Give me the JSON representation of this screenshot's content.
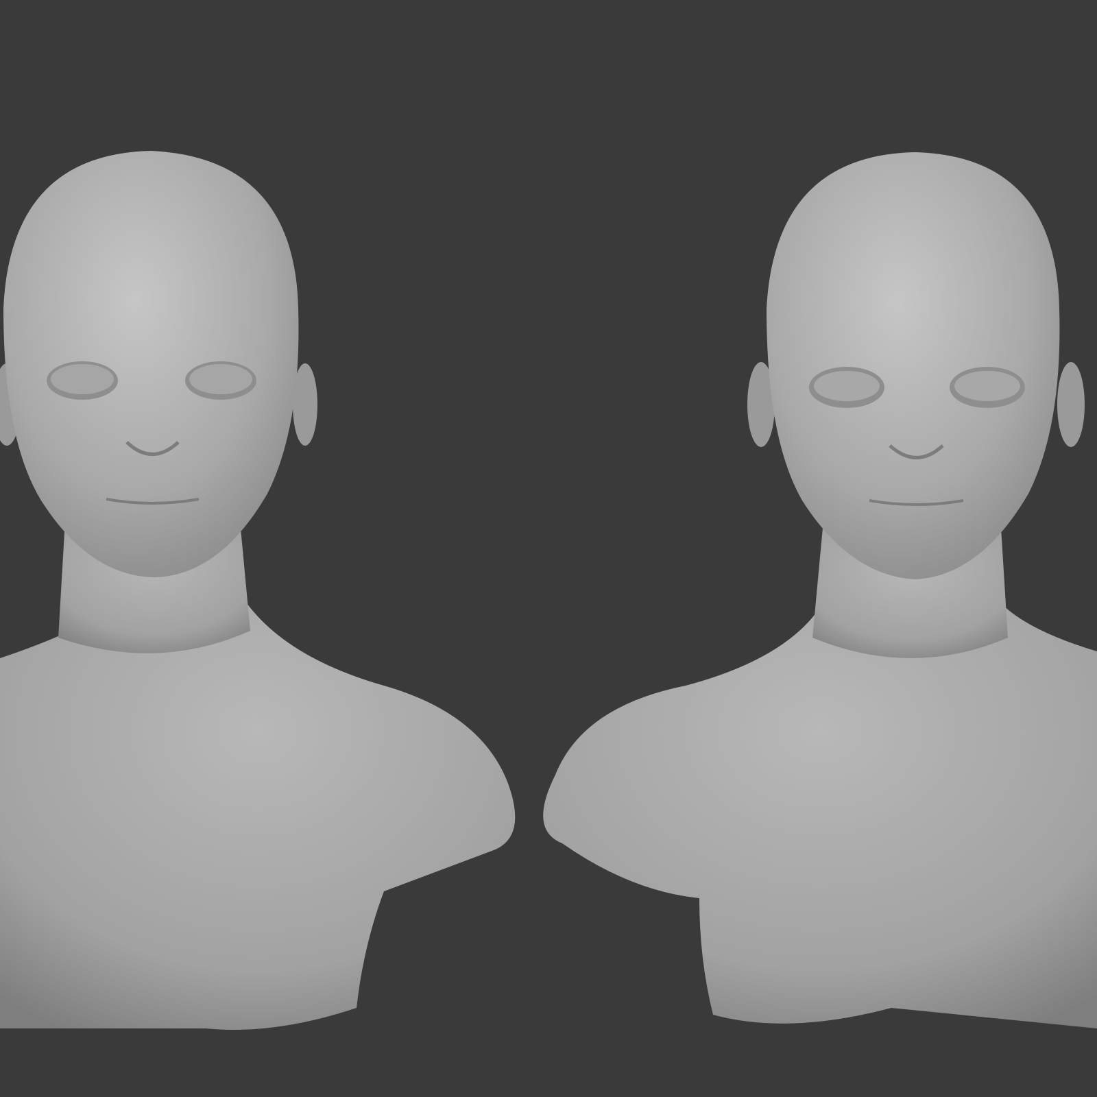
{
  "viewport": {
    "background_color": "#3a3a3a",
    "model_color": "#a8a8a8",
    "highlight_color": "#c4c4c4",
    "shadow_color": "#7a7a7a"
  }
}
